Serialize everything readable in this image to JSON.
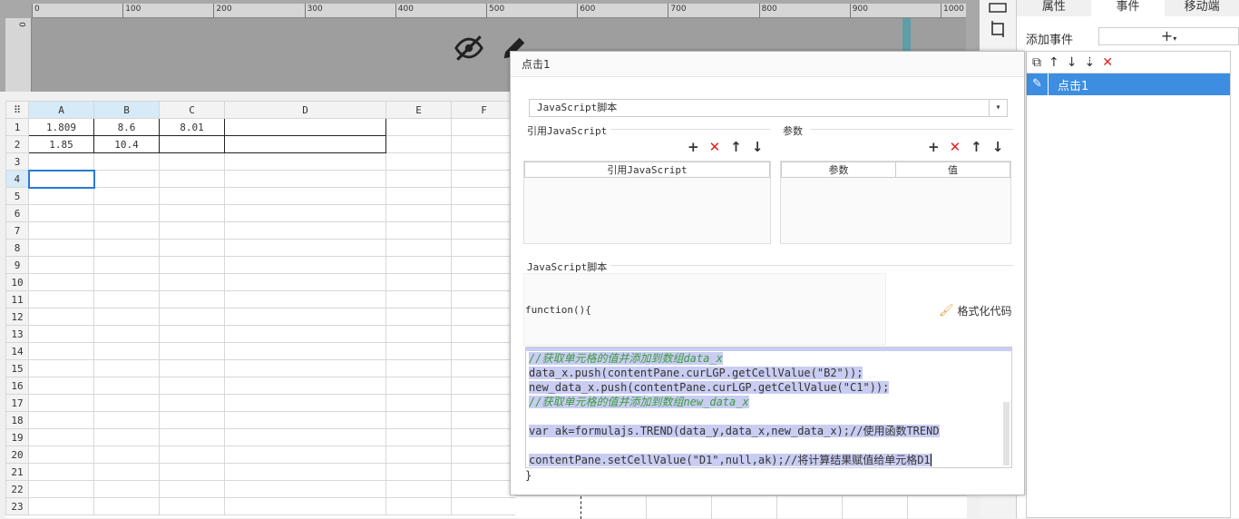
{
  "ruler": {
    "ticks": [
      "0",
      "100",
      "200",
      "300",
      "400",
      "500",
      "600",
      "700",
      "800",
      "900",
      "1000"
    ],
    "left_tick": "0"
  },
  "sheet": {
    "columns": [
      "A",
      "B",
      "C",
      "D",
      "E",
      "F"
    ],
    "rows": [
      "1",
      "2",
      "3",
      "4",
      "5",
      "6",
      "7",
      "8",
      "9",
      "10",
      "11",
      "12",
      "13",
      "14",
      "15",
      "16",
      "17",
      "18",
      "19",
      "20",
      "21",
      "22",
      "23"
    ],
    "cells": {
      "A1": "1.809",
      "B1": "8.6",
      "C1": "8.01",
      "A2": "1.85",
      "B2": "10.4"
    },
    "selected_cell": "A4"
  },
  "right_panel": {
    "tabs": [
      "属性",
      "事件",
      "移动端"
    ],
    "active_tab": "事件",
    "add_event_label": "添加事件",
    "add_event_button": "+",
    "event_item": "点击1"
  },
  "dialog": {
    "title": "点击1",
    "type_value": "JavaScript脚本",
    "ref_js_label": "引用JavaScript",
    "params_label": "参数",
    "ref_js_column": "引用JavaScript",
    "params_column": "参数",
    "value_column": "值",
    "script_label": "JavaScript脚本",
    "function_header": "function(){",
    "format_button": "格式化代码",
    "closing_brace": "}",
    "code_lines": [
      "//获取单元格的值并添加到数组data_x",
      "data_x.push(contentPane.curLGP.getCellValue(\"B2\"));",
      "new_data_x.push(contentPane.curLGP.getCellValue(\"C1\"));",
      "//获取单元格的值并添加到数组new_data_x",
      "",
      "var ak=formulajs.TREND(data_y,data_x,new_data_x);//使用函数TREND",
      "",
      "contentPane.setCellValue(\"D1\",null,ak);//将计算结果赋值给单元格D1"
    ]
  },
  "colors": {
    "accent": "#3d8de0",
    "delete": "#e02020",
    "highlight": "#c9cdf2",
    "comment": "#3c9a3c"
  }
}
